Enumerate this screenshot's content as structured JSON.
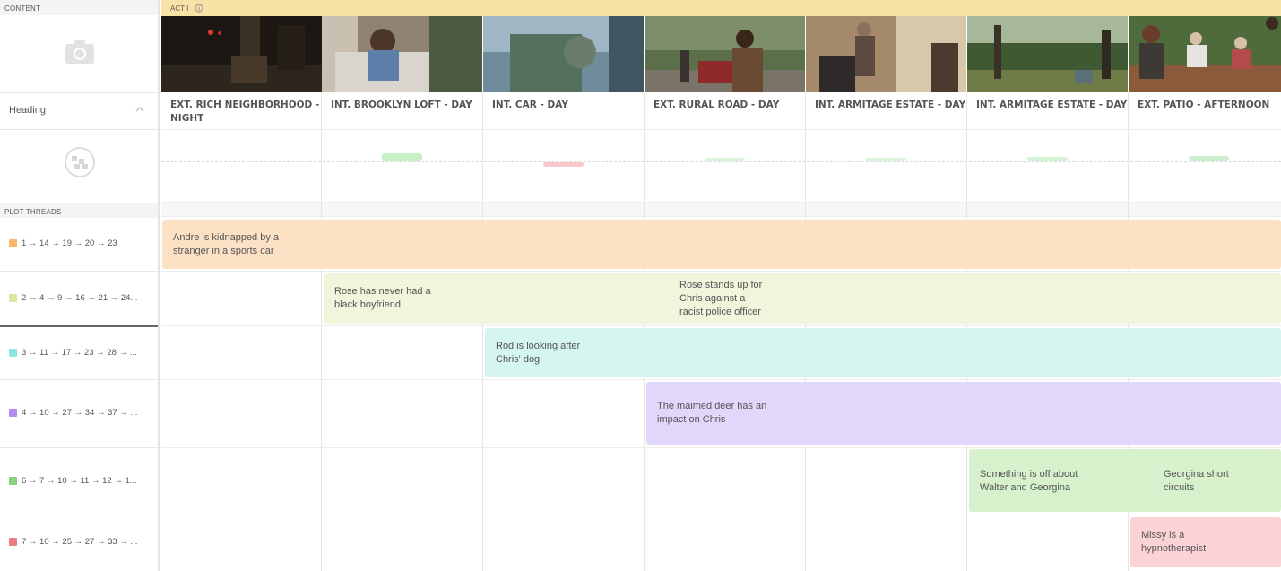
{
  "sidebar": {
    "content_label": "CONTENT",
    "heading_label": "Heading",
    "plot_threads_label": "PLOT THREADS",
    "threads": [
      {
        "label": "1 → 14 → 19 → 20 → 23",
        "color": "#f6b866"
      },
      {
        "label": "2 → 4 → 9 → 16 → 21 → 24...",
        "color": "#dce8a0"
      },
      {
        "label": "3 → 11 → 17 → 23 → 28 → ...",
        "color": "#8fe6dd"
      },
      {
        "label": "4 → 10 → 27 → 34 → 37 → ...",
        "color": "#b78cf0"
      },
      {
        "label": "6 → 7 → 10 → 11 → 12 → 1...",
        "color": "#86d27a"
      },
      {
        "label": "7 → 10 → 25 → 27 → 33 → ...",
        "color": "#ee7c86"
      }
    ]
  },
  "act": {
    "label": "ACT I"
  },
  "scenes": [
    {
      "heading": "EXT. RICH NEIGHBORHOOD - NIGHT"
    },
    {
      "heading": "INT. BROOKLYN LOFT - DAY"
    },
    {
      "heading": "INT. CAR - DAY"
    },
    {
      "heading": "EXT. RURAL ROAD - DAY"
    },
    {
      "heading": "INT. ARMITAGE ESTATE - DAY"
    },
    {
      "heading": "INT. ARMITAGE ESTATE - DAY"
    },
    {
      "heading": "EXT. PATIO - AFTERNOON"
    }
  ],
  "cards": [
    {
      "text": "Andre is kidnapped by a\nstranger in a sports car",
      "color": "#fde1c4"
    },
    {
      "text": "Rose has never had a\nblack boyfriend",
      "color": "#f2f4dc"
    },
    {
      "text": "Rose stands up for\nChris against a\nracist police officer",
      "color": "#f2f4dc"
    },
    {
      "text": "Rod is looking after\nChris' dog",
      "color": "#d5f5f0"
    },
    {
      "text": "The maimed deer has an\nimpact on Chris",
      "color": "#e2d6fa"
    },
    {
      "text": "Something is off about\nWalter and Georgina",
      "color": "#d6f1cc"
    },
    {
      "text": "Georgina short\ncircuits",
      "color": "#d6f1cc"
    },
    {
      "text": "Missy is a\nhypnotherapist",
      "color": "#fbd3d6"
    }
  ]
}
